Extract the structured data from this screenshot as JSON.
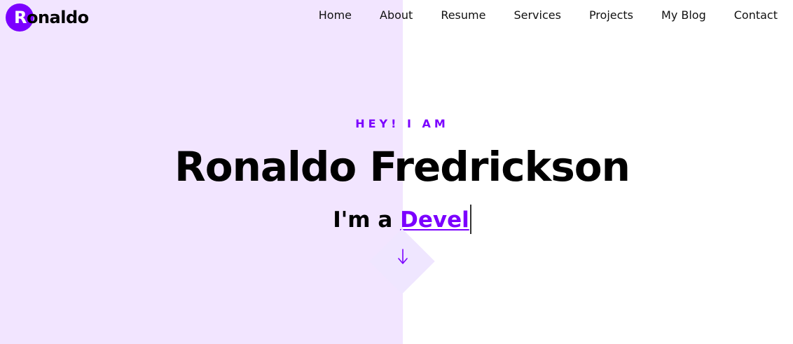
{
  "logo": {
    "first_letter": "R",
    "rest": "onaldo"
  },
  "nav": {
    "items": [
      "Home",
      "About",
      "Resume",
      "Services",
      "Projects",
      "My Blog",
      "Contact"
    ]
  },
  "hero": {
    "eyebrow": "HEY! I AM",
    "name": "Ronaldo Fredrickson",
    "tagline_prefix": "I'm a ",
    "typed_text": "Devel"
  },
  "icons": {
    "scroll": "arrow-down-icon"
  },
  "colors": {
    "accent": "#7b00ff",
    "hero_left_bg": "#f2e5ff",
    "diamond_bg": "#efe6ff",
    "page_bg": "#ffffff"
  }
}
